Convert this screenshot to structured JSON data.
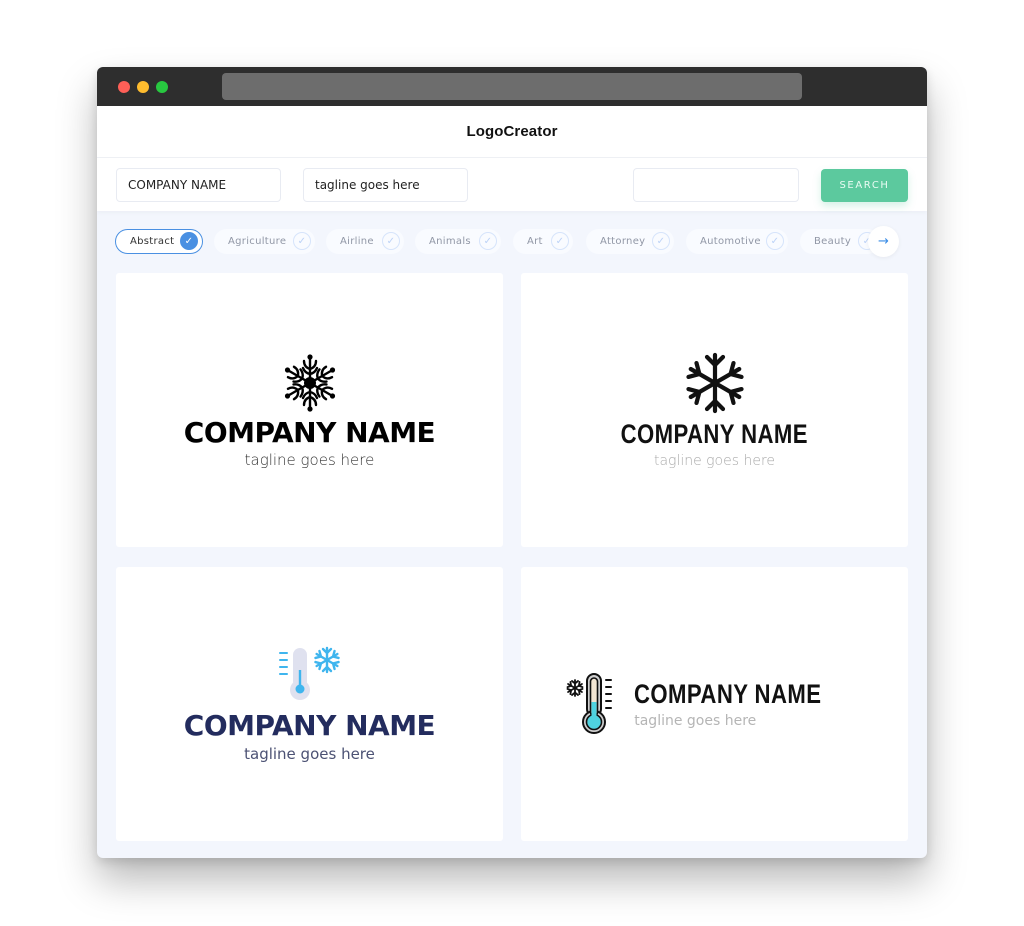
{
  "browser": {
    "controls": [
      "close",
      "minimize",
      "maximize"
    ],
    "url": ""
  },
  "header": {
    "brand": "LogoCreator"
  },
  "search": {
    "company_value": "COMPANY NAME",
    "tagline_value": "tagline goes here",
    "extra_value": "",
    "button_label": "SEARCH",
    "button_color": "#5cc99e"
  },
  "categories": {
    "items": [
      {
        "label": "Abstract",
        "active": true
      },
      {
        "label": "Agriculture",
        "active": false
      },
      {
        "label": "Airline",
        "active": false
      },
      {
        "label": "Animals",
        "active": false
      },
      {
        "label": "Art",
        "active": false
      },
      {
        "label": "Attorney",
        "active": false
      },
      {
        "label": "Automotive",
        "active": false
      },
      {
        "label": "Beauty",
        "active": false
      }
    ],
    "check_icon": "✓",
    "next_icon": "→",
    "accent": "#4a90e2"
  },
  "logos": [
    {
      "icon": "ornate-snowflake",
      "company": "COMPANY NAME",
      "tagline": "tagline goes here"
    },
    {
      "icon": "snowflake",
      "company": "COMPANY NAME",
      "tagline": "tagline goes here"
    },
    {
      "icon": "thermometer-snowflake",
      "company": "COMPANY NAME",
      "tagline": "tagline goes here"
    },
    {
      "icon": "thermometer-outline-snowflake",
      "company": "COMPANY NAME",
      "tagline": "tagline goes here"
    }
  ]
}
